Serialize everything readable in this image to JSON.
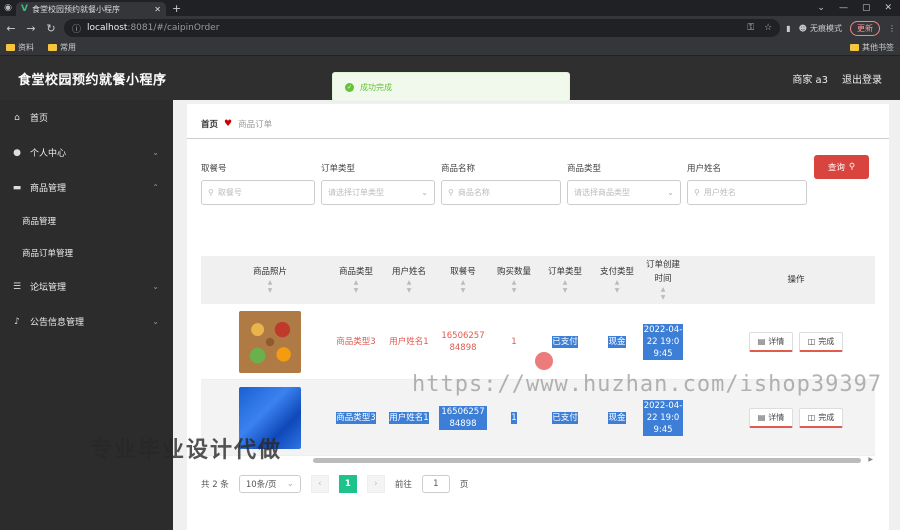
{
  "browser": {
    "tab_title": "食堂校园预约就餐小程序",
    "url_host": "localhost",
    "url_path": ":8081/#/caipinOrder",
    "incognito_label": "无痕模式",
    "update_label": "更新",
    "bookmarks": [
      "资料",
      "常用"
    ],
    "bookmarks_right": "其他书签"
  },
  "header": {
    "title": "食堂校园预约就餐小程序",
    "user": "商家 a3",
    "logout": "退出登录"
  },
  "toast": {
    "message": "成功完成"
  },
  "sidebar": {
    "items": [
      {
        "label": "首页"
      },
      {
        "label": "个人中心"
      },
      {
        "label": "商品管理"
      },
      {
        "label": "论坛管理"
      },
      {
        "label": "公告信息管理"
      }
    ],
    "sub_items": [
      "商品管理",
      "商品订单管理"
    ]
  },
  "breadcrumb": {
    "home": "首页",
    "current": "商品订单"
  },
  "filters": [
    {
      "label": "取餐号",
      "placeholder": "取餐号"
    },
    {
      "label": "订单类型",
      "placeholder": "请选择订单类型"
    },
    {
      "label": "商品名称",
      "placeholder": "商品名称"
    },
    {
      "label": "商品类型",
      "placeholder": "请选择商品类型"
    },
    {
      "label": "用户姓名",
      "placeholder": "用户姓名"
    }
  ],
  "query_button": "查询",
  "table": {
    "headers": [
      "商品照片",
      "商品类型",
      "用户姓名",
      "取餐号",
      "购买数量",
      "订单类型",
      "支付类型",
      "订单创建时间",
      "操作"
    ],
    "rows": [
      {
        "category": "商品类型3",
        "user": "用户姓名1",
        "pickup": "1650625784898",
        "qty": "1",
        "order_type": "已支付",
        "pay_type": "现金",
        "created": "2022-04-22 19:09:45"
      },
      {
        "category": "商品类型3",
        "user": "用户姓名1",
        "pickup": "1650625784898",
        "qty": "1",
        "order_type": "已支付",
        "pay_type": "现金",
        "created": "2022-04-22 19:09:45"
      }
    ],
    "detail_label": "详情",
    "finish_label": "完成"
  },
  "pager": {
    "total": "共 2 条",
    "page_size": "10条/页",
    "current": "1",
    "goto_prefix": "前往",
    "goto_value": "1",
    "goto_suffix": "页"
  },
  "watermarks": {
    "url": "https://www.huzhan.com/ishop39397",
    "slogan": "专业毕业设计代做"
  }
}
